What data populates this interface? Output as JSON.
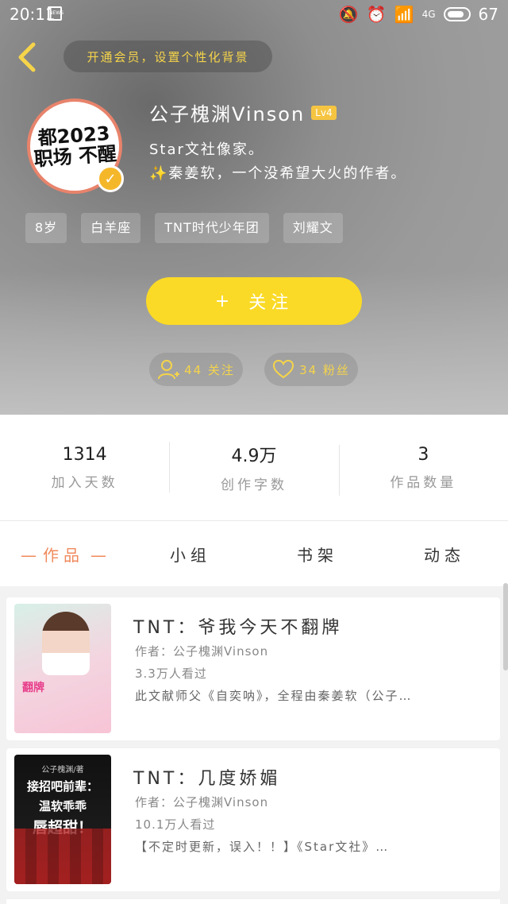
{
  "statusbar": {
    "time": "20:11",
    "news": "NEWS",
    "network": "4G",
    "battery": "67"
  },
  "header": {
    "vip_text": "开通会员，设置个性化背景",
    "username": "公子槐渊Vinson",
    "level": "Lv4",
    "bio_line1": "Star文社像家。",
    "bio_line2": "✨秦姜软，一个没希望大火的作者。",
    "avatar_text": "都2023 职场 不醒",
    "tags": [
      "8岁",
      "白羊座",
      "TNT时代少年团",
      "刘耀文"
    ],
    "follow_label": "关注",
    "follow_plus": "+",
    "following_text": "44 关注",
    "fans_text": "34 粉丝"
  },
  "stats": [
    {
      "value": "1314",
      "label": "加入天数"
    },
    {
      "value": "4.9万",
      "label": "创作字数"
    },
    {
      "value": "3",
      "label": "作品数量"
    }
  ],
  "tabs": [
    {
      "label": "作品",
      "active": true
    },
    {
      "label": "小组",
      "active": false
    },
    {
      "label": "书架",
      "active": false
    },
    {
      "label": "动态",
      "active": false
    }
  ],
  "books": [
    {
      "title": "TNT：爷我今天不翻牌",
      "author": "作者：公子槐渊Vinson",
      "views": "3.3万人看过",
      "desc": "此文献师父《自奕呐》，全程由秦姜软（公子…",
      "cover_title": "翻牌"
    },
    {
      "title": "TNT：几度娇媚",
      "author": "作者：公子槐渊Vinson",
      "views": "10.1万人看过",
      "desc": "【不定时更新，误入！！】《Star文社》…",
      "cover_author": "公子槐渊/著",
      "cover_line1": "接招吧前辈：",
      "cover_line2": "温软乖乖",
      "cover_line3": "唇超甜！"
    }
  ]
}
